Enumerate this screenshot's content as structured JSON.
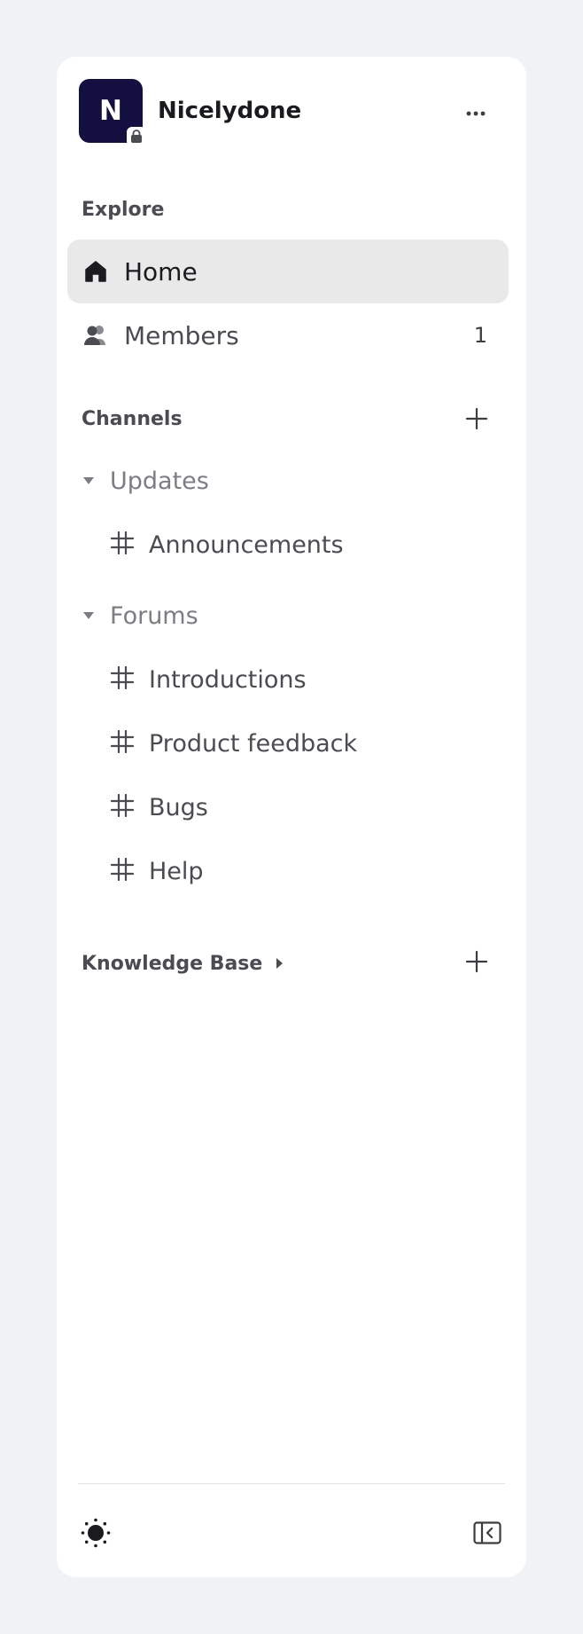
{
  "workspace": {
    "initial": "N",
    "name": "Nicelydone",
    "avatar_color": "#130f40",
    "locked_icon": "lock-icon",
    "more_icon": "more-horizontal-icon"
  },
  "explore": {
    "title": "Explore",
    "items": [
      {
        "label": "Home",
        "icon": "home-icon",
        "active": true
      },
      {
        "label": "Members",
        "icon": "members-icon",
        "count": "1"
      }
    ]
  },
  "channels": {
    "title": "Channels",
    "add_icon": "plus-icon",
    "categories": [
      {
        "label": "Updates",
        "expanded": true,
        "channels": [
          "Announcements"
        ]
      },
      {
        "label": "Forums",
        "expanded": true,
        "channels": [
          "Introductions",
          "Product feedback",
          "Bugs",
          "Help"
        ]
      }
    ]
  },
  "knowledge_base": {
    "title": "Knowledge Base",
    "expanded": false,
    "add_icon": "plus-icon"
  },
  "footer": {
    "theme_icon": "sun-icon",
    "collapse_icon": "collapse-sidebar-icon"
  },
  "colors": {
    "background": "#f0f3f6",
    "panel": "#ffffff",
    "active_item": "#e9e9ea",
    "text_muted": "#4b4c52"
  }
}
